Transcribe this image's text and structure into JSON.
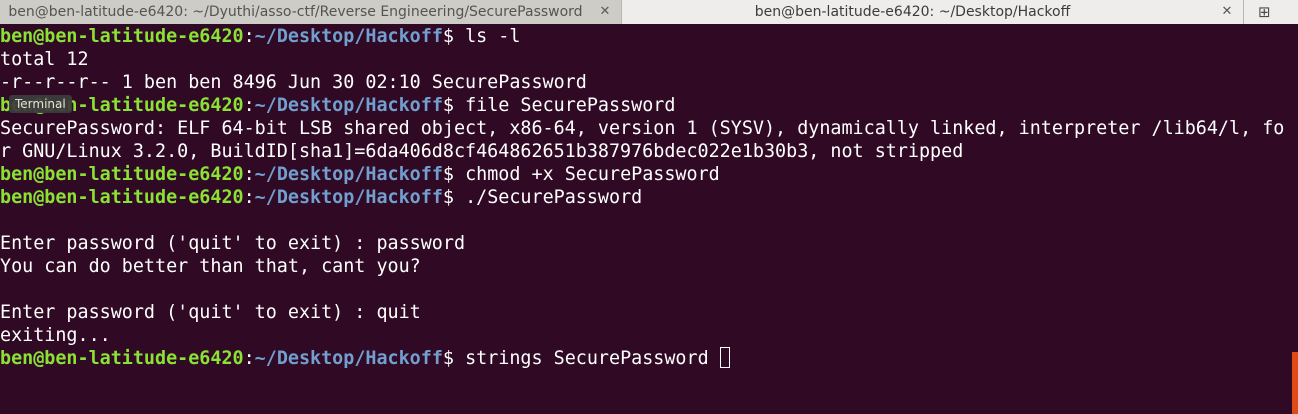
{
  "tabs": [
    {
      "title": "ben@ben-latitude-e6420: ~/Dyuthi/asso-ctf/Reverse Engineering/SecurePassword",
      "close": "✕"
    },
    {
      "title": "ben@ben-latitude-e6420: ~/Desktop/Hackoff",
      "close": "✕"
    }
  ],
  "new_tab_icon": "⊞",
  "tooltip": "Terminal",
  "prompt": {
    "user": "ben@ben-latitude-e6420",
    "sep": ":",
    "path": "~/Desktop/Hackoff",
    "symbol": "$ "
  },
  "lines": [
    {
      "type": "prompt",
      "cmd": "ls -l"
    },
    {
      "type": "out",
      "text": "total 12"
    },
    {
      "type": "out",
      "text": "-r--r--r-- 1 ben ben 8496 Jun 30 02:10 SecurePassword"
    },
    {
      "type": "prompt",
      "cmd": "file SecurePassword"
    },
    {
      "type": "out",
      "text": "SecurePassword: ELF 64-bit LSB shared object, x86-64, version 1 (SYSV), dynamically linked, interpreter /lib64/l, fo"
    },
    {
      "type": "out",
      "text": "r GNU/Linux 3.2.0, BuildID[sha1]=6da406d8cf464862651b387976bdec022e1b30b3, not stripped"
    },
    {
      "type": "prompt",
      "cmd": "chmod +x SecurePassword"
    },
    {
      "type": "prompt",
      "cmd": "./SecurePassword"
    },
    {
      "type": "out",
      "text": ""
    },
    {
      "type": "out",
      "text": "Enter password ('quit' to exit) : password"
    },
    {
      "type": "out",
      "text": "You can do better than that, cant you?"
    },
    {
      "type": "out",
      "text": ""
    },
    {
      "type": "out",
      "text": "Enter password ('quit' to exit) : quit"
    },
    {
      "type": "out",
      "text": "exiting..."
    },
    {
      "type": "prompt",
      "cmd": "strings SecurePassword "
    }
  ],
  "colors": {
    "background": "#300a24",
    "user": "#8ae234",
    "path": "#729fcf",
    "text": "#ffffff",
    "scrollbar": "#df4a16"
  }
}
